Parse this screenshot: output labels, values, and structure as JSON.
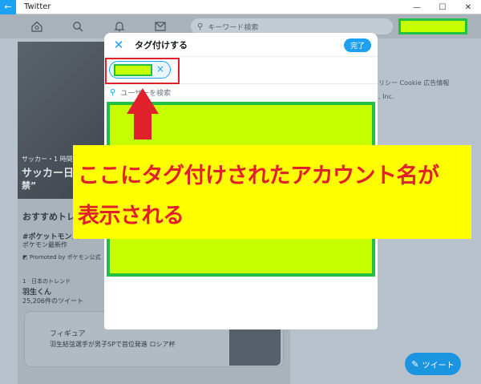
{
  "window": {
    "back_icon": "arrow-left-icon",
    "title": "Twitter",
    "minimize": "—",
    "maximize": "☐",
    "close": "✕"
  },
  "nav": {
    "search_placeholder": "キーワード検索"
  },
  "background": {
    "hero_category": "サッカー・1 時間前",
    "hero_title_line1": "サッカー日",
    "hero_title_line2": "禁”",
    "trends_heading": "おすすめトレ",
    "trend1_name": "#ポケットモンス",
    "trend1_desc": "ポケモン最新作",
    "trend1_promoted": "Promoted by ポケモン公式",
    "trend2_meta": "1 · 日本のトレンド",
    "trend2_name": "羽生くん",
    "trend2_count": "25,206件のツイート",
    "card_category": "フィギュア",
    "card_text": "羽生結弦選手が男子SPで首位発進 ロシア杯",
    "right_links": "リシー  Cookie  広告情報",
    "right_inc": ", Inc."
  },
  "modal": {
    "title": "タグ付けする",
    "done_label": "完了",
    "chip_remove": "×",
    "user_search_placeholder": "ユーザーを検索"
  },
  "annotation": {
    "line1": "ここにタグ付けされたアカウント名が",
    "line2": "表示される"
  },
  "tweet_button": {
    "label": "ツイート"
  },
  "colors": {
    "accent": "#1da1f2",
    "highlight": "#c6ff00",
    "highlight_border": "#22c040",
    "annotation_bg": "#ffff00",
    "annotation_text": "#e0202a"
  }
}
